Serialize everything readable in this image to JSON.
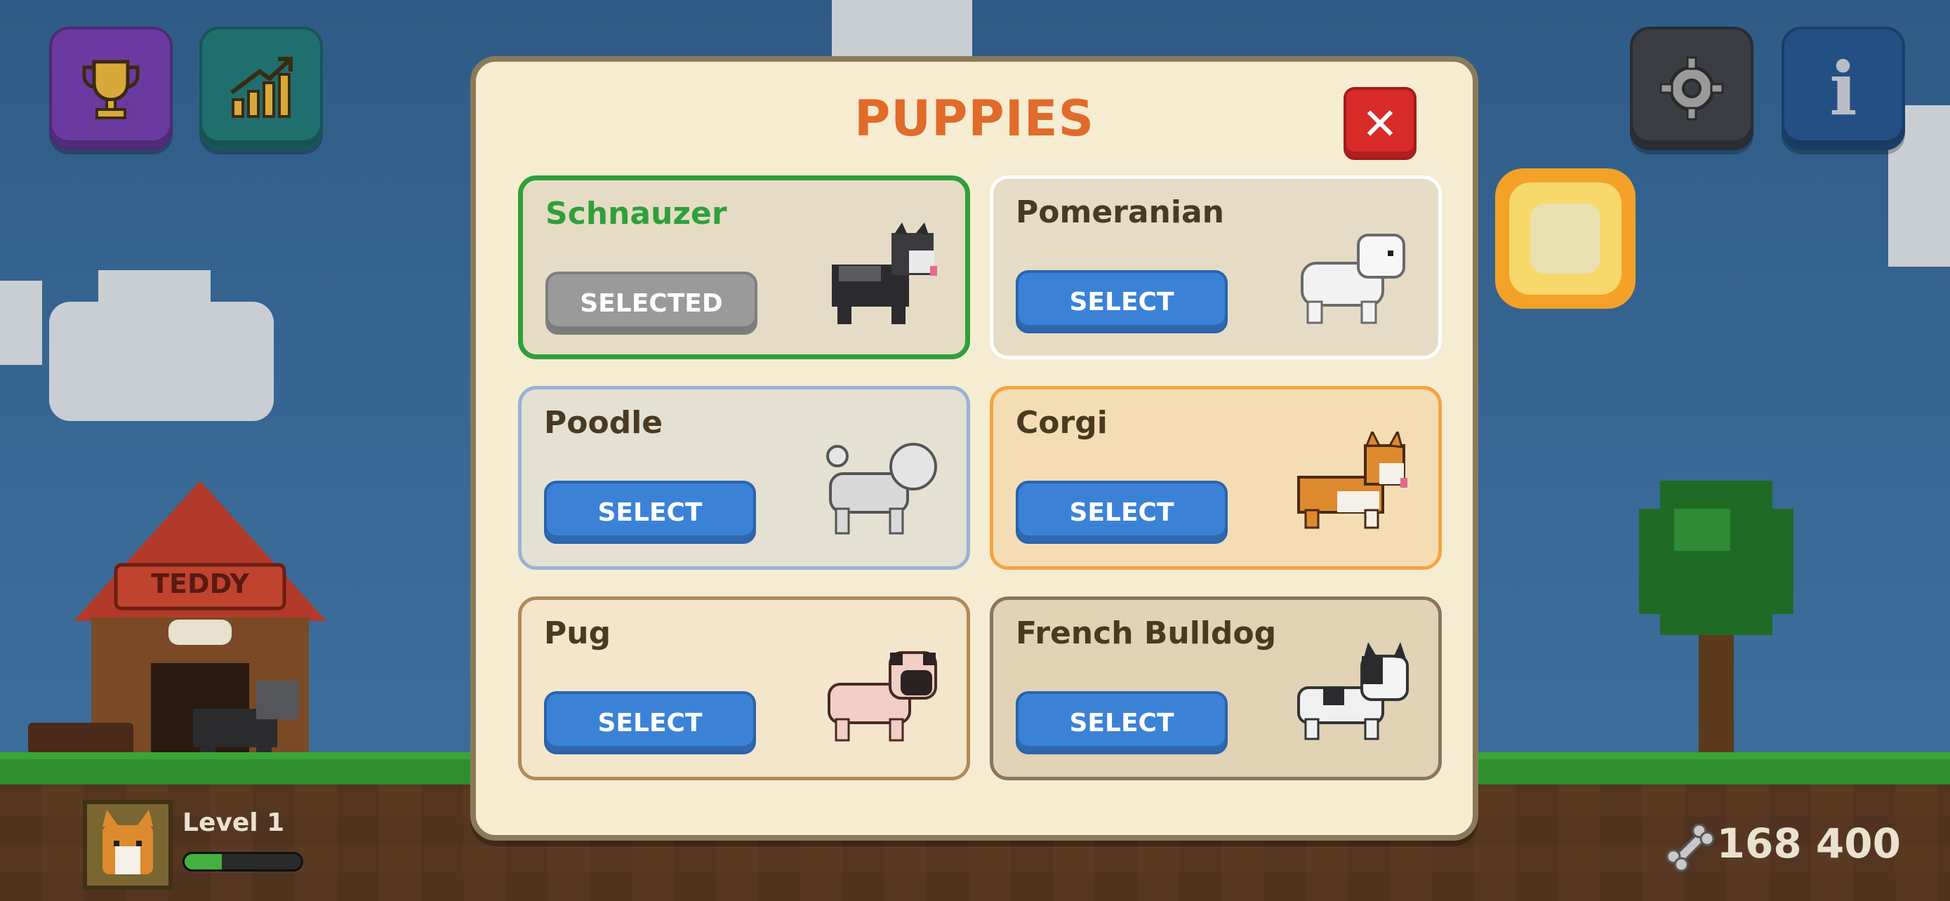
{
  "modal": {
    "title": "PUPPIES",
    "close_label": "✕"
  },
  "puppies": [
    {
      "name": "Schnauzer",
      "button": "SELECTED",
      "state": "selected",
      "name_color": "#2ea03a",
      "border_color": "#2ea03a",
      "bg": "#e6dcc5"
    },
    {
      "name": "Pomeranian",
      "button": "SELECT",
      "state": "available",
      "name_color": "#4a3a22",
      "border_color": "#ffffff",
      "bg": "#e6dcc5"
    },
    {
      "name": "Poodle",
      "button": "SELECT",
      "state": "available",
      "name_color": "#4a3a22",
      "border_color": "#9ab1d6",
      "bg": "#e4e1d2"
    },
    {
      "name": "Corgi",
      "button": "SELECT",
      "state": "available",
      "name_color": "#4a3a22",
      "border_color": "#f2a444",
      "bg": "#f4ddb5"
    },
    {
      "name": "Pug",
      "button": "SELECT",
      "state": "available",
      "name_color": "#4a3a22",
      "border_color": "#b08a5a",
      "bg": "#f4e6cb"
    },
    {
      "name": "French Bulldog",
      "button": "SELECT",
      "state": "available",
      "name_color": "#4a3a22",
      "border_color": "#8a7560",
      "bg": "#e2d2b6"
    }
  ],
  "hud": {
    "icons": [
      "trophy-icon",
      "chart-icon",
      "gear-icon",
      "info-icon"
    ],
    "info_glyph": "i",
    "level": "Level 1",
    "xp_fraction": 0.32,
    "currency": "168 400",
    "doghouse_sign": "TEDDY"
  },
  "colors": {
    "accent_title": "#e06b2a",
    "select_blue": "#3b82d6",
    "close_red": "#d92a2a"
  }
}
